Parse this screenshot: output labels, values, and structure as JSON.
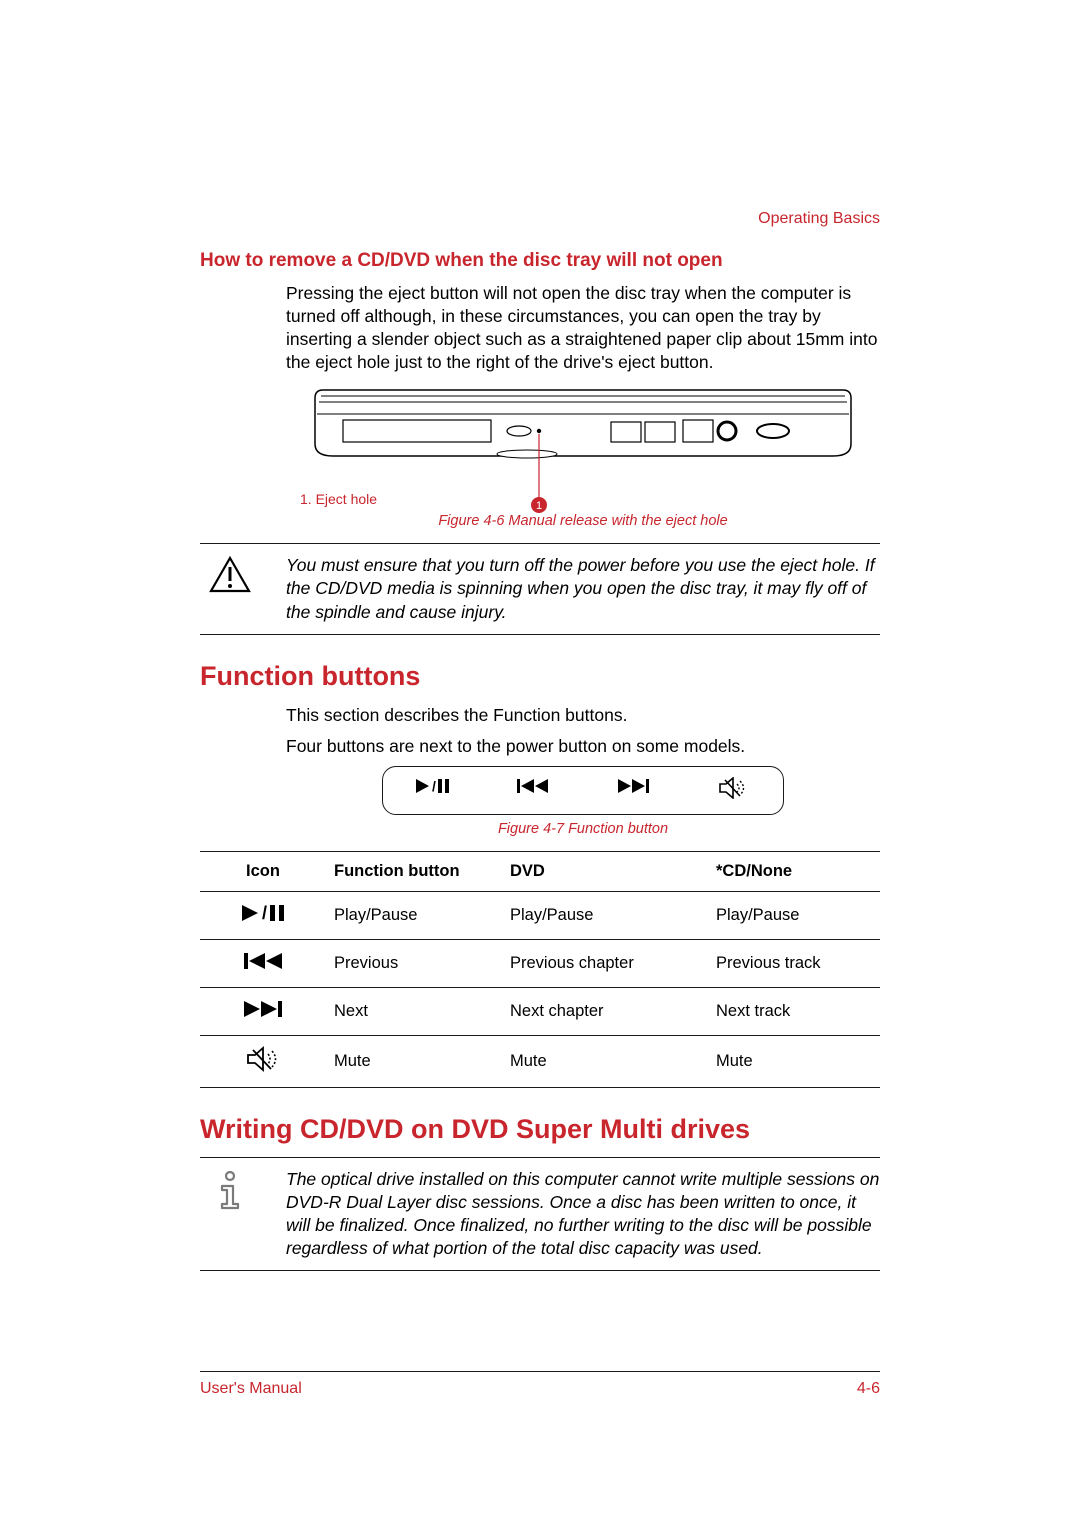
{
  "header": {
    "chapter": "Operating Basics"
  },
  "sectionA": {
    "title": "How to remove a CD/DVD when the disc tray will not open",
    "paragraph": "Pressing the eject button will not open the disc tray when the computer is turned off although, in these circumstances, you can open the tray by inserting a slender object such as a straightened paper clip about 15mm into the eject hole just to the right of the drive's eject button.",
    "legend": "1. Eject hole",
    "figure_caption": "Figure 4-6 Manual release with the eject hole",
    "callout_number": "1"
  },
  "warning": {
    "text": "You must ensure that you turn off the power before you use the eject hole. If the CD/DVD media is spinning when you open the disc tray, it may fly off of the spindle and cause injury."
  },
  "sectionB": {
    "title": "Function buttons",
    "line1": "This section describes the Function buttons.",
    "line2": "Four buttons are next to the power button on some models.",
    "figure_caption": "Figure 4-7 Function button"
  },
  "table": {
    "headers": {
      "icon": "Icon",
      "fb": "Function button",
      "dvd": "DVD",
      "cd": "*CD/None"
    },
    "rows": [
      {
        "icon": "play-pause",
        "fb": "Play/Pause",
        "dvd": "Play/Pause",
        "cd": "Play/Pause"
      },
      {
        "icon": "previous",
        "fb": "Previous",
        "dvd": "Previous chapter",
        "cd": "Previous track"
      },
      {
        "icon": "next",
        "fb": "Next",
        "dvd": "Next chapter",
        "cd": "Next track"
      },
      {
        "icon": "mute",
        "fb": "Mute",
        "dvd": "Mute",
        "cd": "Mute"
      }
    ]
  },
  "sectionC": {
    "title": "Writing CD/DVD on DVD Super Multi drives"
  },
  "info": {
    "text": "The optical drive installed on this computer cannot write multiple sessions on DVD-R Dual Layer disc sessions. Once a disc has been written to once, it will be finalized. Once finalized, no further writing to the disc will be possible regardless of what portion of the total disc capacity was used."
  },
  "footer": {
    "left": "User's Manual",
    "right": "4-6"
  }
}
